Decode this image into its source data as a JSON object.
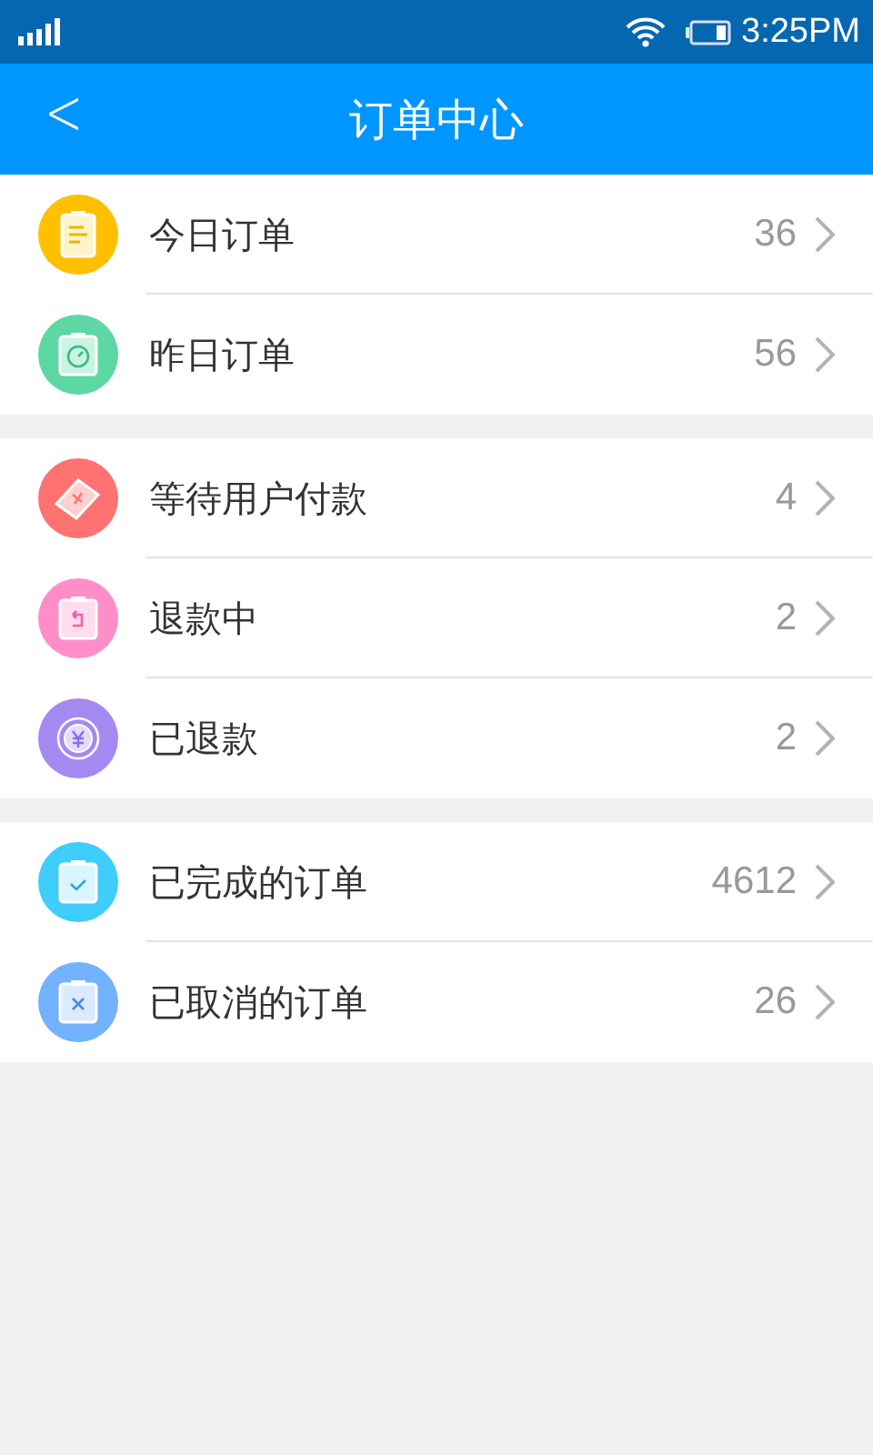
{
  "status_bar": {
    "time": "3:25PM"
  },
  "header": {
    "back": "<",
    "title": "订单中心"
  },
  "groups": [
    {
      "items": [
        {
          "kind": "list",
          "label": "今日订单",
          "count": "36",
          "color": "#ffc000"
        },
        {
          "kind": "clock",
          "label": "昨日订单",
          "count": "56",
          "color": "#5dd8a4"
        }
      ]
    },
    {
      "items": [
        {
          "kind": "ticket",
          "label": "等待用户付款",
          "count": "4",
          "color": "#ff7272"
        },
        {
          "kind": "return",
          "label": "退款中",
          "count": "2",
          "color": "#ff8ec8"
        },
        {
          "kind": "coin",
          "label": "已退款",
          "count": "2",
          "color": "#a48af0"
        }
      ]
    },
    {
      "items": [
        {
          "kind": "check",
          "label": "已完成的订单",
          "count": "4612",
          "color": "#3fcdfb"
        },
        {
          "kind": "cross",
          "label": "已取消的订单",
          "count": "26",
          "color": "#72b2ff"
        }
      ]
    }
  ]
}
